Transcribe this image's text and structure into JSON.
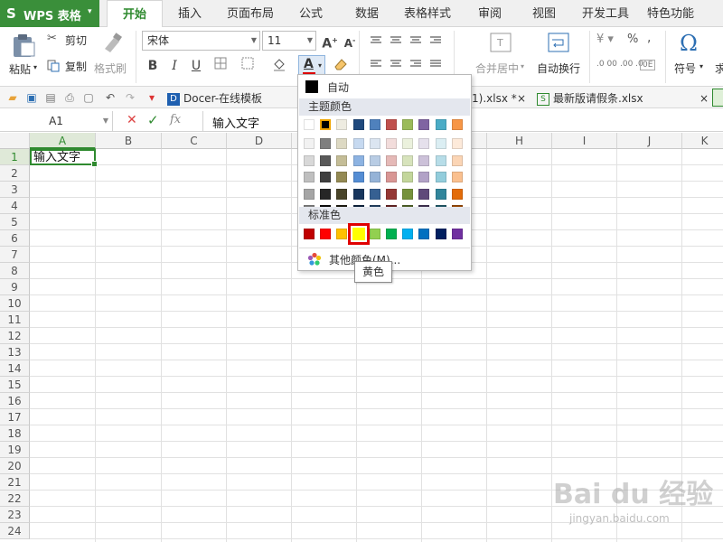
{
  "app": {
    "logo": "S",
    "name": "WPS 表格",
    "menu_arrow": "▾"
  },
  "tabs": [
    {
      "label": "开始",
      "active": true
    },
    {
      "label": "插入"
    },
    {
      "label": "页面布局"
    },
    {
      "label": "公式"
    },
    {
      "label": "数据"
    },
    {
      "label": "表格样式"
    },
    {
      "label": "审阅"
    },
    {
      "label": "视图"
    },
    {
      "label": "开发工具"
    },
    {
      "label": "特色功能"
    }
  ],
  "ribbon": {
    "paste": "粘贴",
    "cut": "剪切",
    "copy": "复制",
    "format_painter": "格式刷",
    "font_name": "宋体",
    "font_size": "11",
    "bold": "B",
    "italic": "I",
    "underline": "U",
    "merge_center": "合并居中",
    "wrap_text": "自动换行",
    "symbol": "符号",
    "percent": "%",
    "comma": ","
  },
  "quickbar": {
    "docer_tab": "Docer-在线模板",
    "file_tab_1": "1).xlsx *",
    "file_tab_2": "最新版请假条.xlsx",
    "close": "×"
  },
  "formula_bar": {
    "cell_ref": "A1",
    "fx": "fx",
    "value": "输入文字"
  },
  "sheet": {
    "columns": [
      "A",
      "B",
      "C",
      "D",
      "E",
      "F",
      "G",
      "H",
      "I",
      "J",
      "K"
    ],
    "rows": [
      "1",
      "2",
      "3",
      "4",
      "5",
      "6",
      "7",
      "8",
      "9",
      "10",
      "11",
      "12",
      "13",
      "14",
      "15",
      "16",
      "17",
      "18",
      "19",
      "20",
      "21",
      "22",
      "23",
      "24"
    ],
    "a1_value": "输入文字"
  },
  "color_menu": {
    "auto_label": "自动",
    "theme_header": "主题颜色",
    "standard_header": "标准色",
    "more_colors": "其他颜色(M)...",
    "tooltip": "黄色",
    "selected_color": "#FFFF00",
    "theme_top": [
      "#FFFFFF",
      "#000000",
      "#EEECE1",
      "#1F497D",
      "#4F81BD",
      "#C0504D",
      "#9BBB59",
      "#8064A2",
      "#4BACC6",
      "#F79646"
    ],
    "theme_shades": [
      [
        "#F2F2F2",
        "#7F7F7F",
        "#DDD9C3",
        "#C6D9F0",
        "#DBE5F1",
        "#F2DCDB",
        "#EBF1DD",
        "#E5E0EC",
        "#DBEEF3",
        "#FDEADA"
      ],
      [
        "#D8D8D8",
        "#595959",
        "#C4BD97",
        "#8DB3E2",
        "#B8CCE4",
        "#E5B9B7",
        "#D7E3BC",
        "#CCC1D9",
        "#B7DDE8",
        "#FBD5B5"
      ],
      [
        "#BFBFBF",
        "#3F3F3F",
        "#938953",
        "#548DD4",
        "#95B3D7",
        "#D99694",
        "#C3D69B",
        "#B2A2C7",
        "#92CDDC",
        "#FAC08F"
      ],
      [
        "#A5A5A5",
        "#262626",
        "#494429",
        "#17365D",
        "#366092",
        "#953734",
        "#76923C",
        "#5F497A",
        "#31859B",
        "#E36C09"
      ],
      [
        "#7F7F7F",
        "#0C0C0C",
        "#1D1B10",
        "#0F243E",
        "#244061",
        "#632423",
        "#4F6128",
        "#3F3151",
        "#205867",
        "#974806"
      ]
    ],
    "standard": [
      "#C00000",
      "#FF0000",
      "#FFC000",
      "#FFFF00",
      "#92D050",
      "#00B050",
      "#00B0F0",
      "#0070C0",
      "#002060",
      "#7030A0"
    ]
  },
  "watermark": {
    "brand": "Bai du 经验",
    "url": "jingyan.baidu.com"
  },
  "colors": {
    "accent": "#2F8A2F",
    "highlight": "#E00000",
    "font_color_bar": "#E00000"
  }
}
